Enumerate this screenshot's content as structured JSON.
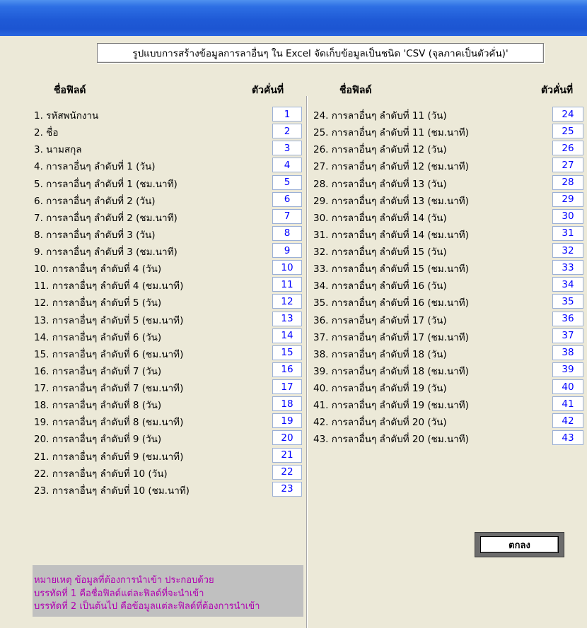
{
  "header_text": "รูปแบบการสร้างข้อมูลการลาอื่นๆ ใน Excel จัดเก็บข้อมูลเป็นชนิด 'CSV (จุลภาคเป็นตัวคั่น)'",
  "columns": {
    "field_name": "ชื่อฟิลด์",
    "delimiter": "ตัวคั่นที่"
  },
  "left_fields": [
    {
      "label": "1. รหัสพนักงาน",
      "value": "1"
    },
    {
      "label": "2. ชื่อ",
      "value": "2"
    },
    {
      "label": "3. นามสกุล",
      "value": "3"
    },
    {
      "label": "4. การลาอื่นๆ ลำดับที่ 1 (วัน)",
      "value": "4"
    },
    {
      "label": "5. การลาอื่นๆ ลำดับที่ 1 (ชม.นาที)",
      "value": "5"
    },
    {
      "label": "6. การลาอื่นๆ ลำดับที่ 2 (วัน)",
      "value": "6"
    },
    {
      "label": "7. การลาอื่นๆ ลำดับที่ 2 (ชม.นาที)",
      "value": "7"
    },
    {
      "label": "8. การลาอื่นๆ ลำดับที่ 3 (วัน)",
      "value": "8"
    },
    {
      "label": "9. การลาอื่นๆ ลำดับที่ 3 (ชม.นาที)",
      "value": "9"
    },
    {
      "label": "10. การลาอื่นๆ ลำดับที่ 4 (วัน)",
      "value": "10"
    },
    {
      "label": "11. การลาอื่นๆ ลำดับที่ 4 (ชม.นาที)",
      "value": "11"
    },
    {
      "label": "12. การลาอื่นๆ ลำดับที่ 5 (วัน)",
      "value": "12"
    },
    {
      "label": "13. การลาอื่นๆ ลำดับที่ 5 (ชม.นาที)",
      "value": "13"
    },
    {
      "label": "14. การลาอื่นๆ ลำดับที่ 6 (วัน)",
      "value": "14"
    },
    {
      "label": "15. การลาอื่นๆ ลำดับที่ 6 (ชม.นาที)",
      "value": "15"
    },
    {
      "label": "16. การลาอื่นๆ ลำดับที่ 7 (วัน)",
      "value": "16"
    },
    {
      "label": "17. การลาอื่นๆ ลำดับที่ 7 (ชม.นาที)",
      "value": "17"
    },
    {
      "label": "18. การลาอื่นๆ ลำดับที่ 8 (วัน)",
      "value": "18"
    },
    {
      "label": "19. การลาอื่นๆ ลำดับที่ 8 (ชม.นาที)",
      "value": "19"
    },
    {
      "label": "20. การลาอื่นๆ ลำดับที่ 9 (วัน)",
      "value": "20"
    },
    {
      "label": "21. การลาอื่นๆ ลำดับที่ 9 (ชม.นาที)",
      "value": "21"
    },
    {
      "label": "22. การลาอื่นๆ ลำดับที่ 10 (วัน)",
      "value": "22"
    },
    {
      "label": "23. การลาอื่นๆ ลำดับที่ 10 (ชม.นาที)",
      "value": "23"
    }
  ],
  "right_fields": [
    {
      "label": "24. การลาอื่นๆ ลำดับที่ 11 (วัน)",
      "value": "24"
    },
    {
      "label": "25. การลาอื่นๆ ลำดับที่ 11 (ชม.นาที)",
      "value": "25"
    },
    {
      "label": "26. การลาอื่นๆ ลำดับที่ 12 (วัน)",
      "value": "26"
    },
    {
      "label": "27. การลาอื่นๆ ลำดับที่ 12 (ชม.นาที)",
      "value": "27"
    },
    {
      "label": "28. การลาอื่นๆ ลำดับที่ 13 (วัน)",
      "value": "28"
    },
    {
      "label": "29. การลาอื่นๆ ลำดับที่ 13 (ชม.นาที)",
      "value": "29"
    },
    {
      "label": "30. การลาอื่นๆ ลำดับที่ 14 (วัน)",
      "value": "30"
    },
    {
      "label": "31. การลาอื่นๆ ลำดับที่ 14 (ชม.นาที)",
      "value": "31"
    },
    {
      "label": "32. การลาอื่นๆ ลำดับที่ 15 (วัน)",
      "value": "32"
    },
    {
      "label": "33. การลาอื่นๆ ลำดับที่ 15 (ชม.นาที)",
      "value": "33"
    },
    {
      "label": "34. การลาอื่นๆ ลำดับที่ 16 (วัน)",
      "value": "34"
    },
    {
      "label": "35. การลาอื่นๆ ลำดับที่ 16 (ชม.นาที)",
      "value": "35"
    },
    {
      "label": "36. การลาอื่นๆ ลำดับที่ 17 (วัน)",
      "value": "36"
    },
    {
      "label": "37. การลาอื่นๆ ลำดับที่ 17 (ชม.นาที)",
      "value": "37"
    },
    {
      "label": "38. การลาอื่นๆ ลำดับที่ 18 (วัน)",
      "value": "38"
    },
    {
      "label": "39. การลาอื่นๆ ลำดับที่ 18 (ชม.นาที)",
      "value": "39"
    },
    {
      "label": "40. การลาอื่นๆ ลำดับที่ 19 (วัน)",
      "value": "40"
    },
    {
      "label": "41. การลาอื่นๆ ลำดับที่ 19 (ชม.นาที)",
      "value": "41"
    },
    {
      "label": "42. การลาอื่นๆ ลำดับที่ 20 (วัน)",
      "value": "42"
    },
    {
      "label": "43. การลาอื่นๆ ลำดับที่ 20 (ชม.นาที)",
      "value": "43"
    }
  ],
  "ok_button_label": "ตกลง",
  "note_lines": [
    "หมายเหตุ ข้อมูลที่ต้องการนำเข้า ประกอบด้วย",
    "บรรทัดที่ 1 คือชื่อฟิลด์แต่ละฟิลด์ที่จะนำเข้า",
    "บรรทัดที่ 2 เป็นต้นไป คือข้อมูลแต่ละฟิลด์ที่ต้องการนำเข้า"
  ],
  "colors": {
    "titlebar": "#1f5ad6",
    "window_bg": "#ece9d8",
    "value_text": "#0000ff",
    "note_text": "#b000b0",
    "note_bg": "#c0c0c0"
  }
}
